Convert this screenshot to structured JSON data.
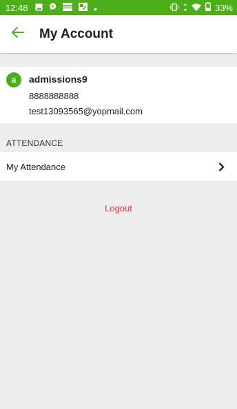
{
  "status_bar": {
    "time": "12:48",
    "battery": "33%",
    "icons": [
      "image-icon",
      "chat-icon",
      "card-icon",
      "calendar-icon",
      "dot-icon",
      "vibrate-icon",
      "signal-icon",
      "wifi-icon",
      "battery-icon"
    ],
    "background": "#4caf1a"
  },
  "toolbar": {
    "title": "My Account",
    "back_icon": "arrow-left-icon",
    "accent": "#4caf1a"
  },
  "profile": {
    "avatar_letter": "a",
    "name": "admissions9",
    "phone": "8888888888",
    "email": "test13093565@yopmail.com"
  },
  "sections": {
    "attendance_header": "ATTENDANCE",
    "my_attendance_label": "My Attendance",
    "chevron_icon": "chevron-right-icon"
  },
  "logout": {
    "label": "Logout",
    "color": "#e53935"
  }
}
